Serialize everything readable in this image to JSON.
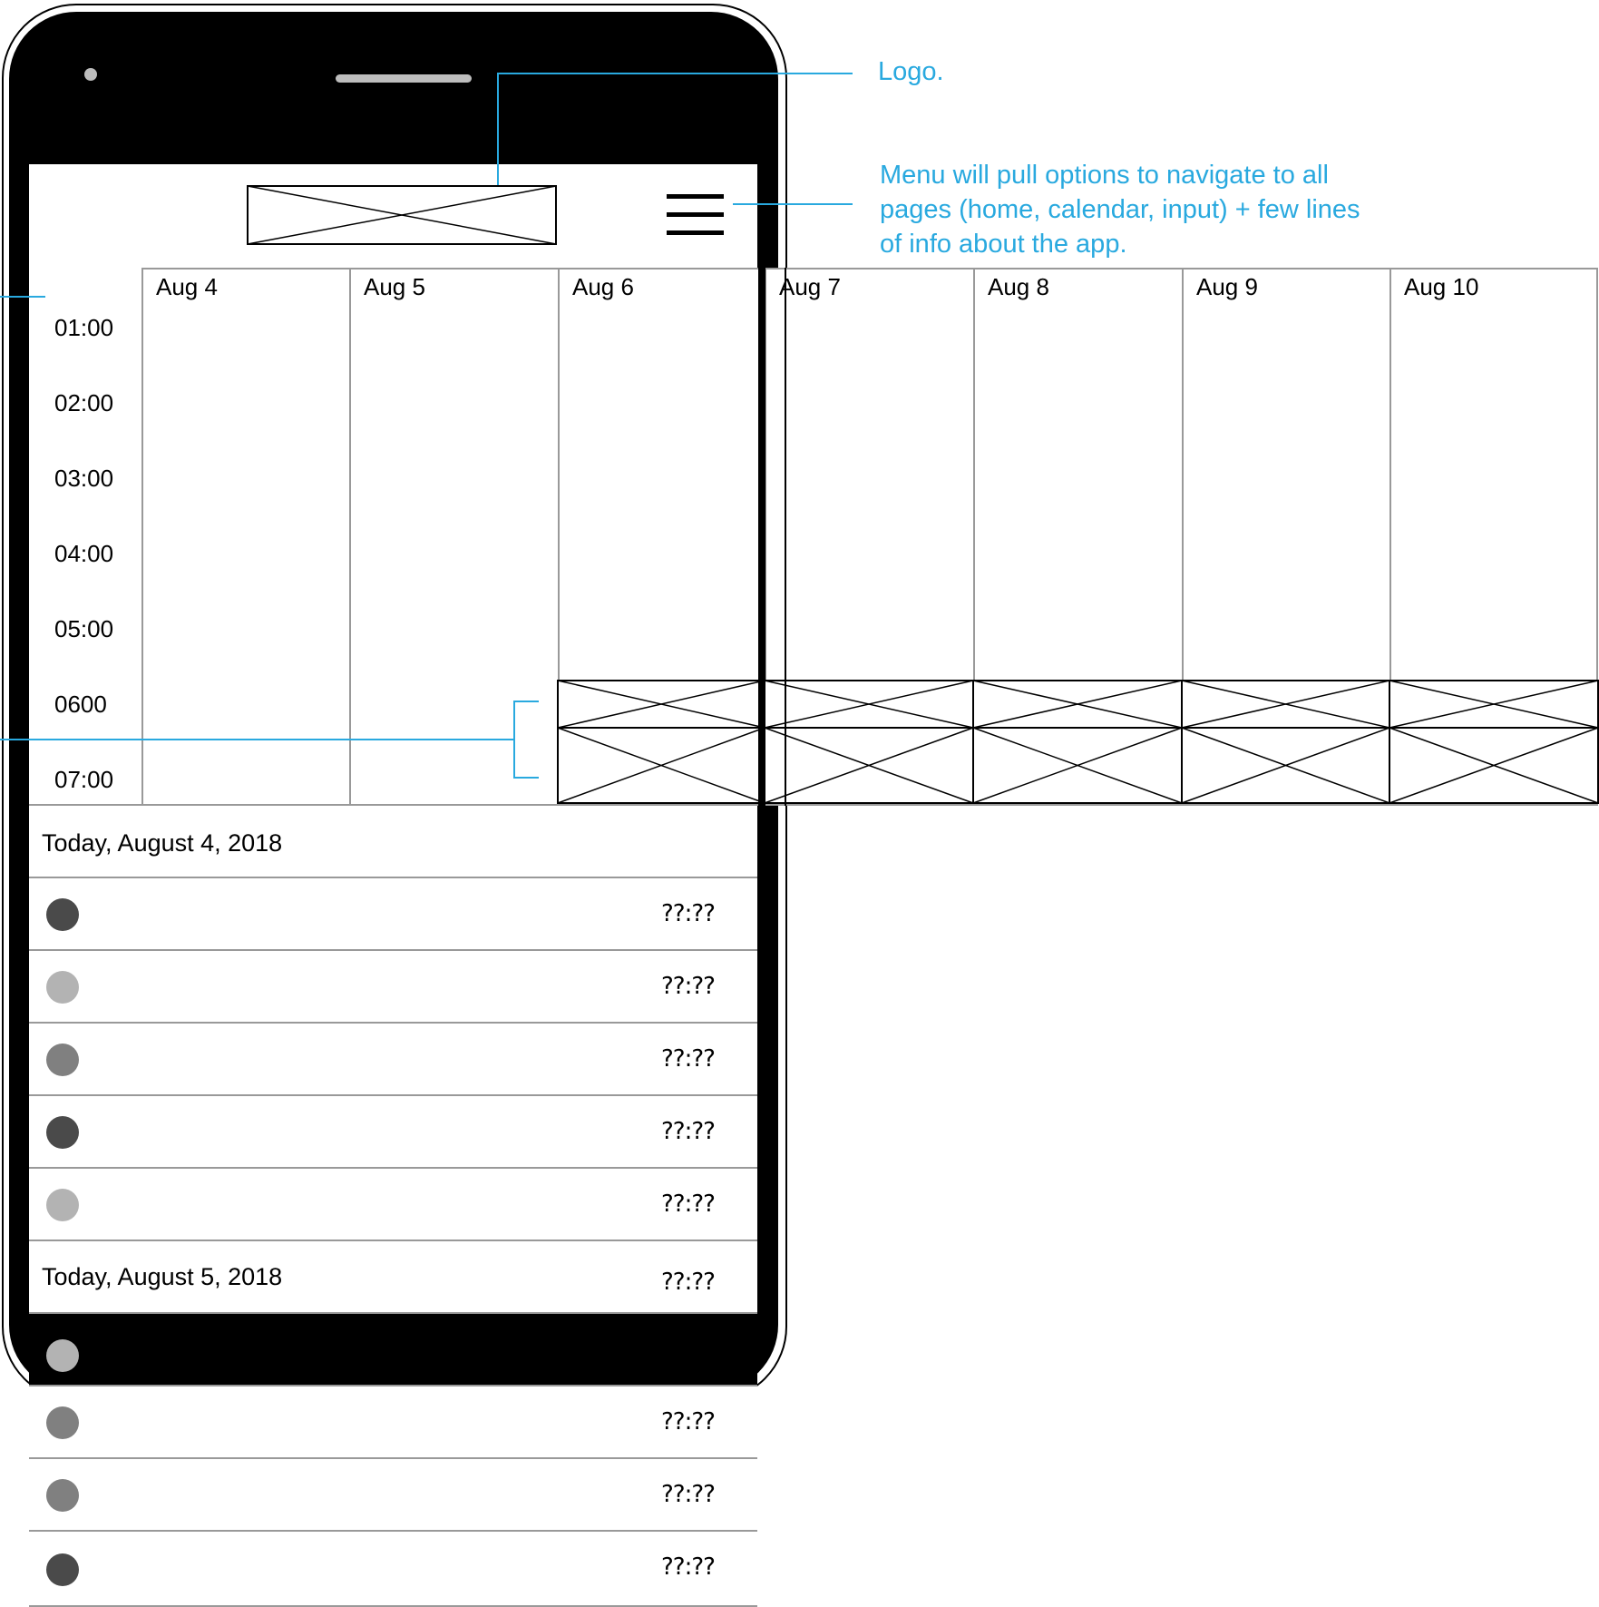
{
  "annotations": {
    "logo": "Logo.",
    "menu": "Menu will pull options to navigate to all pages (home, calendar, input) + few lines of info about the app."
  },
  "calendar": {
    "days": [
      "Aug 4",
      "Aug 5",
      "Aug 6",
      "Aug 7",
      "Aug 8",
      "Aug 9",
      "Aug 10"
    ],
    "times": [
      "01:00",
      "02:00",
      "03:00",
      "04:00",
      "05:00",
      "0600",
      "07:00"
    ]
  },
  "list": {
    "rows": [
      {
        "type": "header",
        "date": "Today, August 4, 2018",
        "time": ""
      },
      {
        "type": "item",
        "dot_color": "#4a4a4a",
        "time": "??:??"
      },
      {
        "type": "item",
        "dot_color": "#b3b3b3",
        "time": "??:??"
      },
      {
        "type": "item",
        "dot_color": "#808080",
        "time": "??:??"
      },
      {
        "type": "item",
        "dot_color": "#4a4a4a",
        "time": "??:??"
      },
      {
        "type": "item",
        "dot_color": "#b3b3b3",
        "time": "??:??"
      },
      {
        "type": "header",
        "date": "Today, August 5, 2018",
        "time": "??:??"
      },
      {
        "type": "item-dark",
        "dot_color": "#b3b3b3",
        "time": ""
      },
      {
        "type": "item",
        "dot_color": "#808080",
        "time": "??:??"
      },
      {
        "type": "item",
        "dot_color": "#808080",
        "time": "??:??"
      },
      {
        "type": "item",
        "dot_color": "#4a4a4a",
        "time": "??:??"
      }
    ]
  },
  "colors": {
    "annotation": "#29a9df",
    "grid": "#999999"
  }
}
